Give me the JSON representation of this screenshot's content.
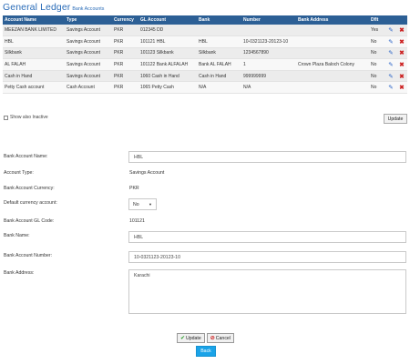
{
  "header": {
    "title": "General Ledger",
    "subtitle": "Bank Accounts"
  },
  "table": {
    "columns": [
      "Account Name",
      "Type",
      "Currency",
      "GL Account",
      "Bank",
      "Number",
      "Bank Address",
      "Dflt",
      "",
      ""
    ],
    "rows": [
      {
        "name": "MEEZAN BANK LIMITED",
        "type": "Savings Account",
        "currency": "PKR",
        "gl": "012345 DD",
        "bank": "",
        "number": "",
        "address": "",
        "dflt": "Yes"
      },
      {
        "name": "HBL",
        "type": "Savings Account",
        "currency": "PKR",
        "gl": "101121 HBL",
        "bank": "HBL",
        "number": "10-0321123-20123-10",
        "address": "",
        "dflt": "No"
      },
      {
        "name": "Silkbank",
        "type": "Savings Account",
        "currency": "PKR",
        "gl": "101123 Silkbank",
        "bank": "Silkbank",
        "number": "1234567890",
        "address": "",
        "dflt": "No"
      },
      {
        "name": "AL FALAH",
        "type": "Savings Account",
        "currency": "PKR",
        "gl": "101122 Bank ALFALAH",
        "bank": "Bank AL FALAH",
        "number": "1",
        "address": "Crown Plaza Baloch Colony",
        "dflt": "No"
      },
      {
        "name": "Cash in Hand",
        "type": "Savings Account",
        "currency": "PKR",
        "gl": "1060 Cash in Hand",
        "bank": "Cash in Hand",
        "number": "999999999",
        "address": "",
        "dflt": "No"
      },
      {
        "name": "Petty Cash account",
        "type": "Cash Account",
        "currency": "PKR",
        "gl": "1065 Petty Cash",
        "bank": "N/A",
        "number": "N/A",
        "address": "",
        "dflt": "No"
      }
    ],
    "edit_icon": "pencil-icon",
    "delete_icon": "x-icon"
  },
  "show_inactive_label": "Show also Inactive",
  "update_top_label": "Update",
  "form": {
    "bank_account_name_label": "Bank Account Name:",
    "bank_account_name_value": "HBL",
    "account_type_label": "Account Type:",
    "account_type_value": "Savings Account",
    "currency_label": "Bank Account Currency:",
    "currency_value": "PKR",
    "default_currency_label": "Default currency account:",
    "default_currency_value": "No",
    "gl_code_label": "Bank Account GL Code:",
    "gl_code_value": "101121",
    "bank_name_label": "Bank Name:",
    "bank_name_value": "HBL",
    "bank_account_number_label": "Bank Account Number:",
    "bank_account_number_value": "10-0321123-20123-10",
    "bank_address_label": "Bank Address:",
    "bank_address_value": "Karachi"
  },
  "buttons": {
    "update": "Update",
    "cancel": "Cancel",
    "back": "Back"
  },
  "colors": {
    "header_bg": "#2c5f95",
    "title": "#2a6cb8",
    "back_btn": "#1aa3e8"
  }
}
